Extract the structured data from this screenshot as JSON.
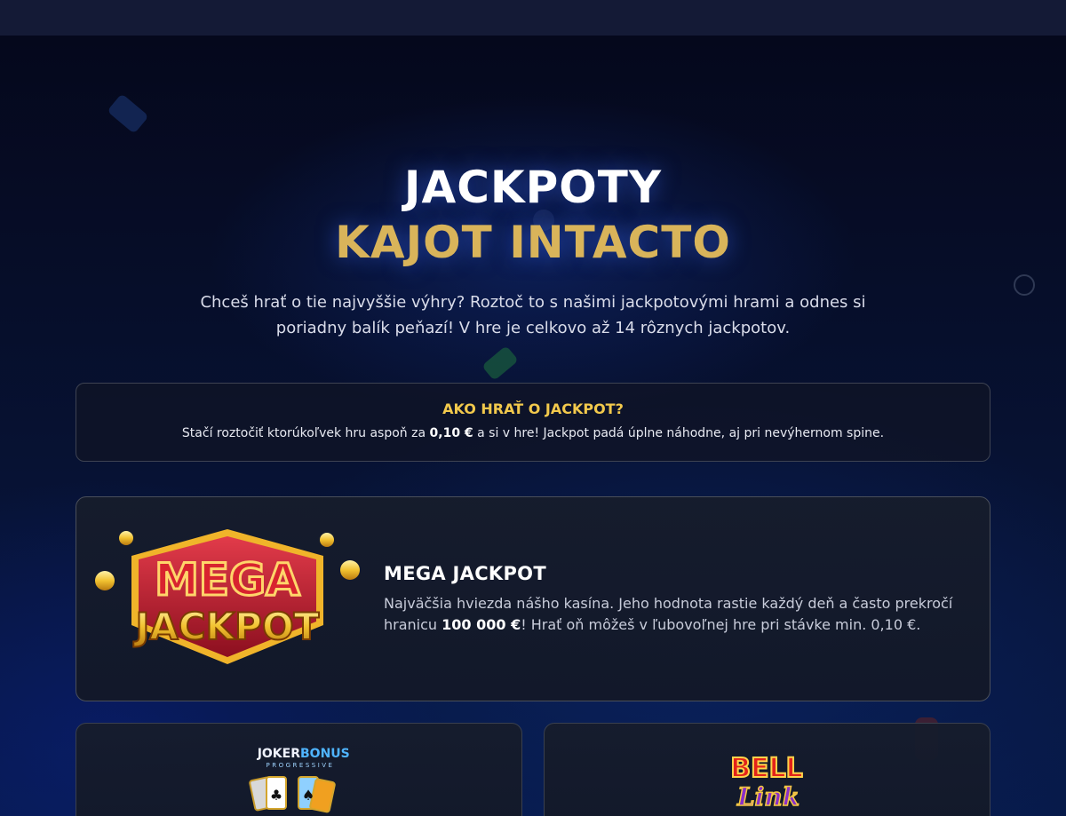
{
  "hero": {
    "title_line1": "JACKPOTY",
    "title_line2": "KAJOT INTACTO",
    "intro": "Chceš hrať o tie najvyššie výhry? Roztoč to s našimi jackpotovými hrami a odnes si poriadny balík peňazí! V hre je celkovo až 14 rôznych jackpotov."
  },
  "how_to": {
    "title": "AKO HRAŤ O JACKPOT?",
    "text_before": "Stačí roztočiť ktorúkoľvek hru aspoň za ",
    "text_bold": "0,10 €",
    "text_after": " a si v hre! Jackpot padá úplne náhodne, aj pri nevýhernom spine."
  },
  "mega_jackpot": {
    "logo_line1": "MEGA",
    "logo_line2": "JACKPOT",
    "title": "MEGA JACKPOT",
    "text_before": "Najväčšia hviezda nášho kasína. Jeho hodnota rastie každý deň a často prekročí hranicu ",
    "text_bold": "100 000 €",
    "text_after": "! Hrať oň môžeš v ľubovoľnej hre pri stávke min. 0,10 €."
  },
  "cards": [
    {
      "logo_word1": "JOKER",
      "logo_word2": "BONUS",
      "logo_sub": "PROGRESSIVE"
    },
    {
      "logo_word1": "BELL",
      "logo_word2": "Link"
    }
  ],
  "colors": {
    "background": "#070b22",
    "topbar": "#141a36",
    "gold": "#d9b45a",
    "howto_title": "#f2c94c"
  }
}
